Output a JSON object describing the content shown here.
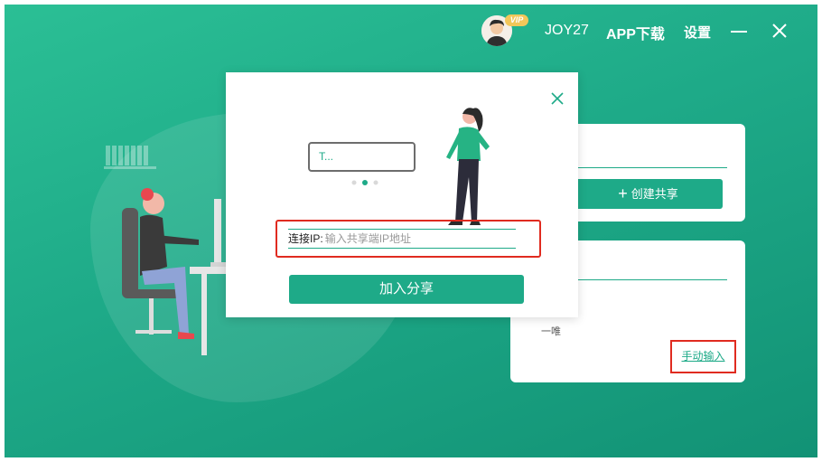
{
  "header": {
    "avatar_icon": "user-avatar",
    "vip_badge": "VIP",
    "username": "JOY27",
    "app_download": "APP下载",
    "settings": "设置",
    "minimize_icon": "minimize-icon",
    "close_icon": "close-icon"
  },
  "cards": {
    "create_button": "创建共享",
    "join_note": "一唯",
    "manual_input": "手动输入"
  },
  "modal": {
    "close_icon": "close-icon",
    "mock_input_text": "T...",
    "ip_label": "连接IP:",
    "ip_placeholder": "输入共享端IP地址",
    "ip_value": "",
    "join_button": "加入分享"
  },
  "colors": {
    "accent": "#1eaa88",
    "highlight_border": "#e02b20",
    "vip": "#f2c75a"
  }
}
